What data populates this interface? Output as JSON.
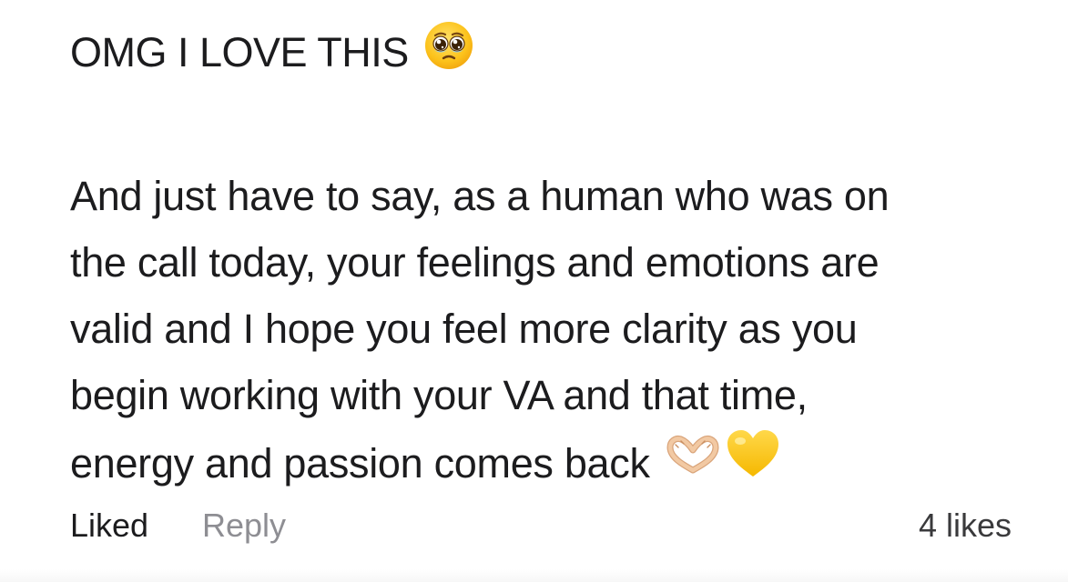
{
  "comment": {
    "headline": "OMG I LOVE THIS",
    "headline_emoji": "pleading-face-icon",
    "body_lines": [
      "And just have to say, as a human who was on",
      "the call today, your feelings and emotions are",
      "valid and I hope you feel more clarity as you",
      "begin working with your VA and that time,",
      "energy and passion comes back"
    ],
    "trailing_emojis": [
      "heart-hands-icon",
      "yellow-heart-icon"
    ]
  },
  "actions": {
    "liked_label": "Liked",
    "reply_label": "Reply",
    "likes_count": "4 likes"
  },
  "colors": {
    "text": "#1c1c1e",
    "secondary": "#8e8e93",
    "emoji_yellow": "#fcc21b",
    "heart_yellow": "#ffcc1a",
    "skin_tone": "#f2c9a3"
  }
}
